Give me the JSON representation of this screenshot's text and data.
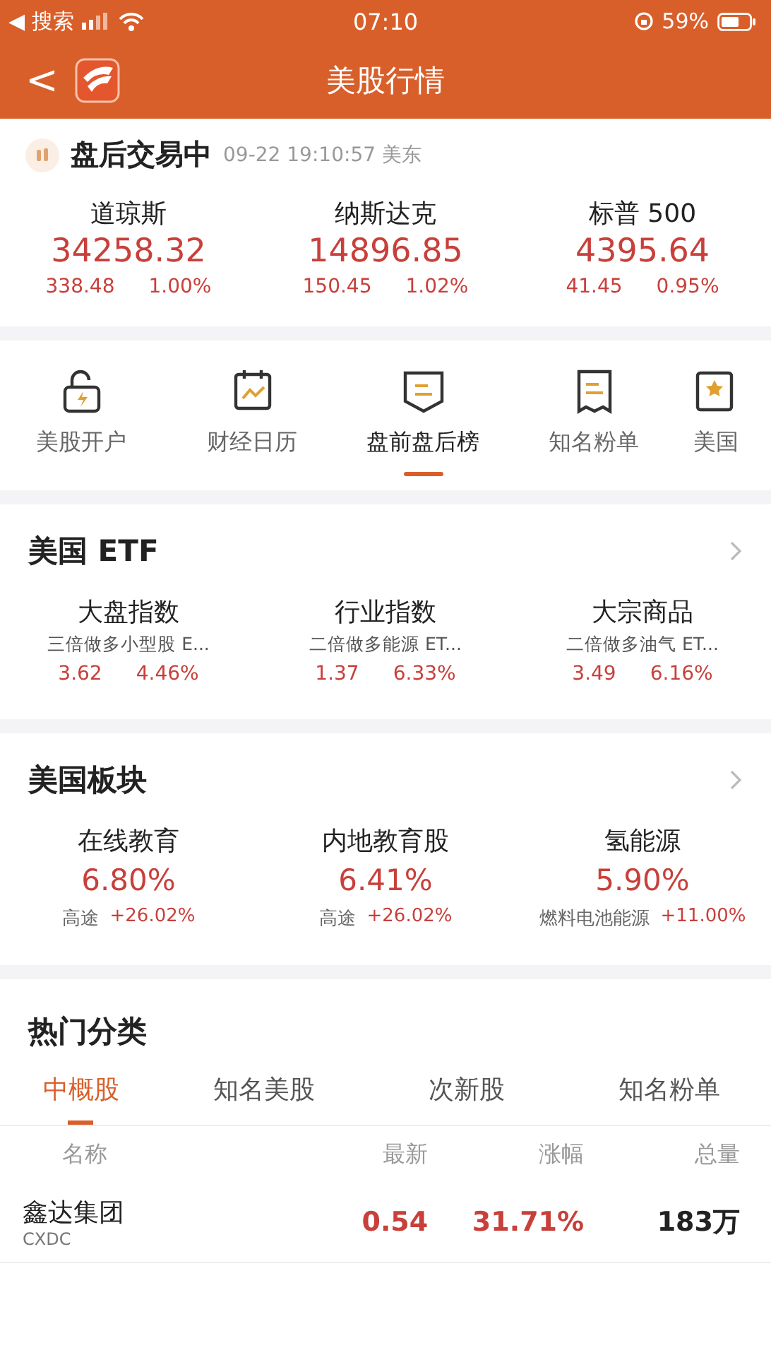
{
  "status_bar": {
    "back_app": "◀ 搜索",
    "time": "07:10",
    "battery": "59%"
  },
  "nav": {
    "back": "<",
    "title": "美股行情"
  },
  "market": {
    "status": "盘后交易中",
    "time": "09-22 19:10:57 美东",
    "indices": [
      {
        "name": "道琼斯",
        "price": "34258.32",
        "change": "338.48",
        "percent": "1.00%"
      },
      {
        "name": "纳斯达克",
        "price": "14896.85",
        "change": "150.45",
        "percent": "1.02%"
      },
      {
        "name": "标普 500",
        "price": "4395.64",
        "change": "41.45",
        "percent": "0.95%"
      }
    ]
  },
  "shortcuts": [
    {
      "label": "美股开户",
      "kind": "lock",
      "selected": false
    },
    {
      "label": "财经日历",
      "kind": "calendar",
      "selected": false
    },
    {
      "label": "盘前盘后榜",
      "kind": "shield",
      "selected": true
    },
    {
      "label": "知名粉单",
      "kind": "receipt",
      "selected": false
    },
    {
      "label": "美国",
      "kind": "star",
      "selected": false
    }
  ],
  "etf": {
    "title": "美国 ETF",
    "items": [
      {
        "name": "大盘指数",
        "fund": "三倍做多小型股 E...",
        "price": "3.62",
        "percent": "4.46%"
      },
      {
        "name": "行业指数",
        "fund": "二倍做多能源 ET...",
        "price": "1.37",
        "percent": "6.33%"
      },
      {
        "name": "大宗商品",
        "fund": "二倍做多油气 ET...",
        "price": "3.49",
        "percent": "6.16%"
      }
    ]
  },
  "sectors": {
    "title": "美国板块",
    "items": [
      {
        "name": "在线教育",
        "percent": "6.80%",
        "leader": "高途",
        "leader_percent": "+26.02%"
      },
      {
        "name": "内地教育股",
        "percent": "6.41%",
        "leader": "高途",
        "leader_percent": "+26.02%"
      },
      {
        "name": "氢能源",
        "percent": "5.90%",
        "leader": "燃料电池能源",
        "leader_percent": "+11.00%"
      }
    ]
  },
  "hot": {
    "title": "热门分类",
    "tabs": [
      {
        "label": "中概股",
        "selected": true
      },
      {
        "label": "知名美股",
        "selected": false
      },
      {
        "label": "次新股",
        "selected": false
      },
      {
        "label": "知名粉单",
        "selected": false
      }
    ],
    "columns": [
      "名称",
      "最新",
      "涨幅",
      "总量"
    ],
    "rows": [
      {
        "name": "鑫达集团",
        "code": "CXDC",
        "price": "0.54",
        "percent": "31.71%",
        "volume": "183万"
      }
    ]
  }
}
